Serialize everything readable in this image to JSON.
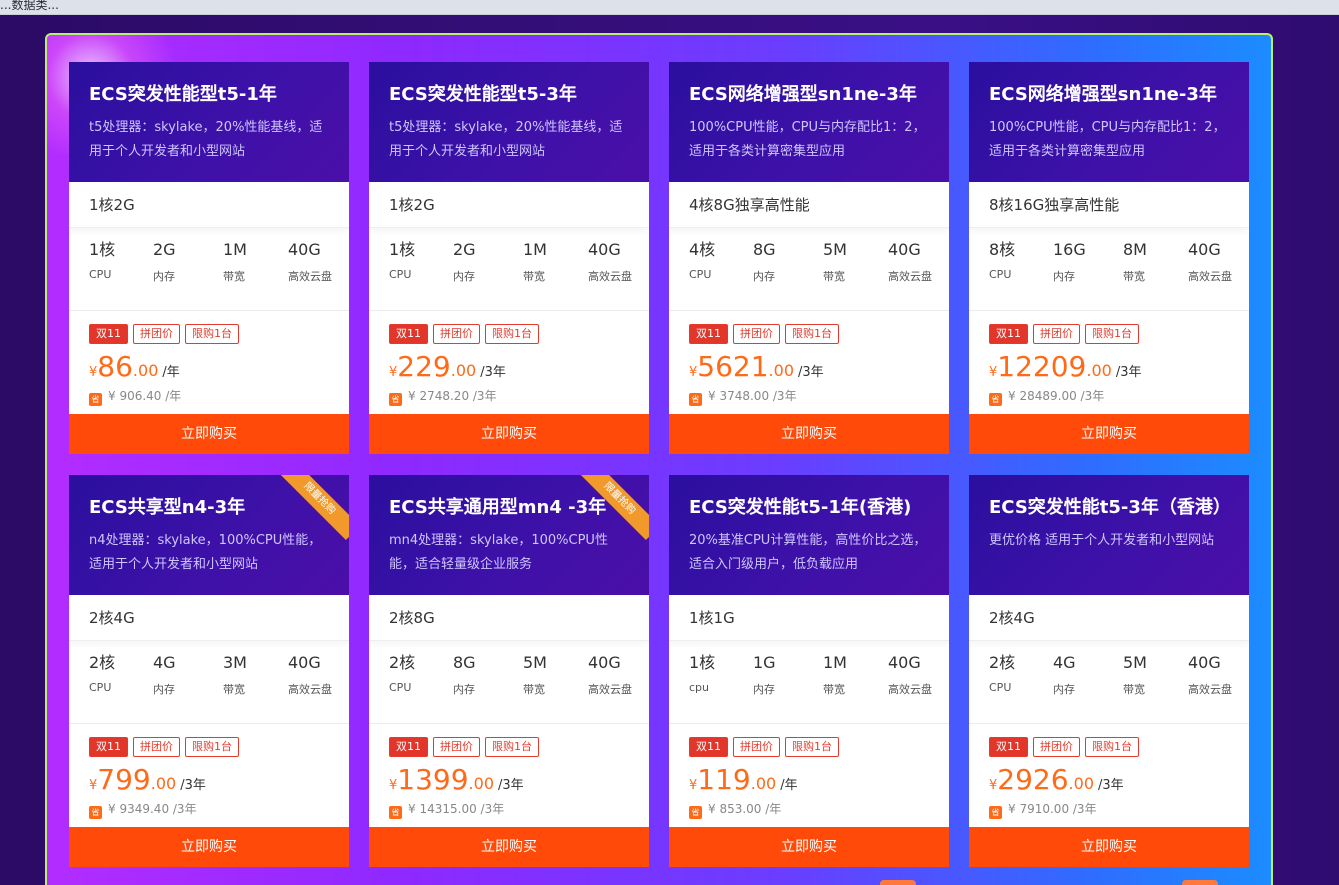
{
  "topbar": {
    "text": "...数据类..."
  },
  "buy_label": "立即购买",
  "tags": [
    "双11",
    "拼团价",
    "限购1台"
  ],
  "save_icon": "省",
  "cards": [
    {
      "title": "ECS突发性能型t5-1年",
      "desc": "t5处理器：skylake，20%性能基线，适用于个人开发者和小型网站",
      "spec": "1核2G",
      "stats": [
        {
          "v": "1核",
          "l": "CPU"
        },
        {
          "v": "2G",
          "l": "内存"
        },
        {
          "v": "1M",
          "l": "带宽"
        },
        {
          "v": "40G",
          "l": "高效云盘"
        }
      ],
      "price": {
        "cur": "¥",
        "int": "86",
        "dec": ".00",
        "unit": "/年"
      },
      "orig": "¥ 906.40 /年",
      "ribbon": ""
    },
    {
      "title": "ECS突发性能型t5-3年",
      "desc": "t5处理器：skylake，20%性能基线，适用于个人开发者和小型网站",
      "spec": "1核2G",
      "stats": [
        {
          "v": "1核",
          "l": "CPU"
        },
        {
          "v": "2G",
          "l": "内存"
        },
        {
          "v": "1M",
          "l": "带宽"
        },
        {
          "v": "40G",
          "l": "高效云盘"
        }
      ],
      "price": {
        "cur": "¥",
        "int": "229",
        "dec": ".00",
        "unit": "/3年"
      },
      "orig": "¥ 2748.20 /3年",
      "ribbon": ""
    },
    {
      "title": "ECS网络增强型sn1ne-3年",
      "desc": "100%CPU性能，CPU与内存配比1：2，适用于各类计算密集型应用",
      "spec": "4核8G独享高性能",
      "stats": [
        {
          "v": "4核",
          "l": "CPU"
        },
        {
          "v": "8G",
          "l": "内存"
        },
        {
          "v": "5M",
          "l": "带宽"
        },
        {
          "v": "40G",
          "l": "高效云盘"
        }
      ],
      "price": {
        "cur": "¥",
        "int": "5621",
        "dec": ".00",
        "unit": "/3年"
      },
      "orig": "¥ 3748.00 /3年",
      "ribbon": ""
    },
    {
      "title": "ECS网络增强型sn1ne-3年",
      "desc": "100%CPU性能，CPU与内存配比1：2，适用于各类计算密集型应用",
      "spec": "8核16G独享高性能",
      "stats": [
        {
          "v": "8核",
          "l": "CPU"
        },
        {
          "v": "16G",
          "l": "内存"
        },
        {
          "v": "8M",
          "l": "带宽"
        },
        {
          "v": "40G",
          "l": "高效云盘"
        }
      ],
      "price": {
        "cur": "¥",
        "int": "12209",
        "dec": ".00",
        "unit": "/3年"
      },
      "orig": "¥ 28489.00 /3年",
      "ribbon": ""
    },
    {
      "title": "ECS共享型n4-3年",
      "desc": "n4处理器：skylake，100%CPU性能，适用于个人开发者和小型网站",
      "spec": "2核4G",
      "stats": [
        {
          "v": "2核",
          "l": "CPU"
        },
        {
          "v": "4G",
          "l": "内存"
        },
        {
          "v": "3M",
          "l": "带宽"
        },
        {
          "v": "40G",
          "l": "高效云盘"
        }
      ],
      "price": {
        "cur": "¥",
        "int": "799",
        "dec": ".00",
        "unit": "/3年"
      },
      "orig": "¥ 9349.40 /3年",
      "ribbon": "限量抢购"
    },
    {
      "title": "ECS共享通用型mn4 -3年",
      "desc": "mn4处理器：skylake，100%CPU性能，适合轻量级企业服务",
      "spec": "2核8G",
      "stats": [
        {
          "v": "2核",
          "l": "CPU"
        },
        {
          "v": "8G",
          "l": "内存"
        },
        {
          "v": "5M",
          "l": "带宽"
        },
        {
          "v": "40G",
          "l": "高效云盘"
        }
      ],
      "price": {
        "cur": "¥",
        "int": "1399",
        "dec": ".00",
        "unit": "/3年"
      },
      "orig": "¥ 14315.00 /3年",
      "ribbon": "限量抢购"
    },
    {
      "title": "ECS突发性能t5-1年(香港)",
      "desc": "20%基准CPU计算性能，高性价比之选，适合入门级用户，低负载应用",
      "spec": "1核1G",
      "stats": [
        {
          "v": "1核",
          "l": "cpu"
        },
        {
          "v": "1G",
          "l": "内存"
        },
        {
          "v": "1M",
          "l": "带宽"
        },
        {
          "v": "40G",
          "l": "高效云盘"
        }
      ],
      "price": {
        "cur": "¥",
        "int": "119",
        "dec": ".00",
        "unit": "/年"
      },
      "orig": "¥ 853.00 /年",
      "ribbon": ""
    },
    {
      "title": "ECS突发性能t5-3年（香港）",
      "desc": "更优价格 适用于个人开发者和小型网站",
      "spec": "2核4G",
      "stats": [
        {
          "v": "2核",
          "l": "CPU"
        },
        {
          "v": "4G",
          "l": "内存"
        },
        {
          "v": "5M",
          "l": "带宽"
        },
        {
          "v": "40G",
          "l": "高效云盘"
        }
      ],
      "price": {
        "cur": "¥",
        "int": "2926",
        "dec": ".00",
        "unit": "/3年"
      },
      "orig": "¥ 7910.00 /3年",
      "ribbon": ""
    }
  ]
}
